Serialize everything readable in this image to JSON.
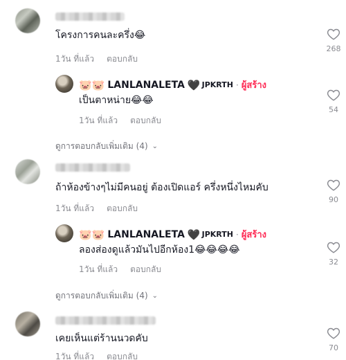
{
  "comments": [
    {
      "text": "โครงการคนละครึ่ง😂",
      "time": "1วัน ที่แล้ว",
      "reply_label": "ตอบกลับ",
      "likes": "268",
      "reply": {
        "author": "LANLANALETA",
        "author_tag": "JPKRTH",
        "creator_label": "ผู้สร้าง",
        "text": "เป็นตาหน่าย😂😂",
        "time": "1วัน ที่แล้ว",
        "reply_label": "ตอบกลับ",
        "likes": "54"
      },
      "more_replies": "ดูการตอบกลับเพิ่มเติม (4)"
    },
    {
      "text": "ถ้าห้องข้างๆไม่มีคนอยู่ ต้องเปิดแอร์ ครึ่งหนึ่งไหมคับ",
      "time": "1วัน ที่แล้ว",
      "reply_label": "ตอบกลับ",
      "likes": "90",
      "reply": {
        "author": "LANLANALETA",
        "author_tag": "JPKRTH",
        "creator_label": "ผู้สร้าง",
        "text": "ลองส่องดูแล้วมันไปอีกห้อง1😂😂😂😂",
        "time": "1วัน ที่แล้ว",
        "reply_label": "ตอบกลับ",
        "likes": "32"
      },
      "more_replies": "ดูการตอบกลับเพิ่มเติม (4)"
    },
    {
      "text": "เคยเห็นแต่ร้านนวดคับ",
      "time": "1วัน ที่แล้ว",
      "reply_label": "ตอบกลับ",
      "likes": "70"
    }
  ],
  "icons": {
    "pig": "🐷",
    "black_heart": "🖤",
    "like": "heart-outline-icon",
    "chevron": "chevron-down-icon"
  },
  "colors": {
    "creator": "#fe2c55",
    "meta": "#8a8b91"
  }
}
